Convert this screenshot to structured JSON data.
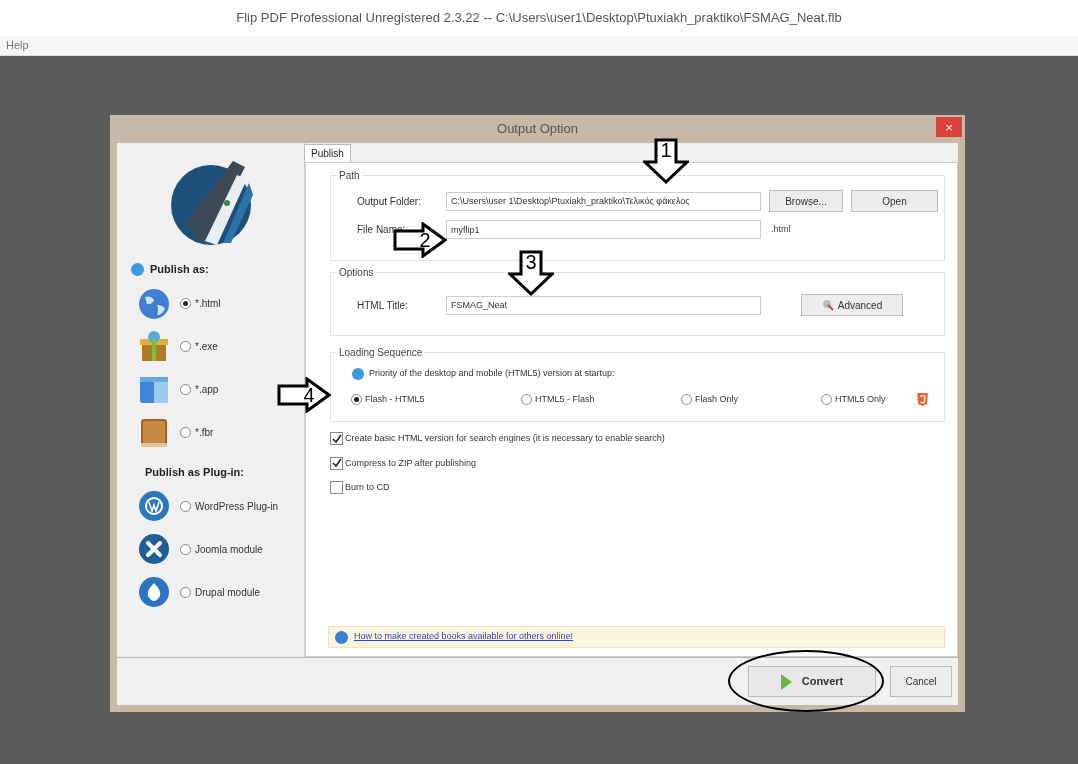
{
  "app_title": "Flip PDF Professional Unregistered 2.3.22  -- C:\\Users\\user1\\Desktop\\Ptuxiakh_praktiko\\FSMAG_Neat.flb",
  "menu": [
    "Help"
  ],
  "dialog": {
    "title": "Output Option",
    "close": "×",
    "tabs": [
      {
        "label": "Publish",
        "selected": true
      }
    ],
    "publish_as": {
      "heading": "Publish as:",
      "options": [
        {
          "label": "*.html",
          "selected": true,
          "kind": "globe"
        },
        {
          "label": "*.exe",
          "selected": false,
          "kind": "package"
        },
        {
          "label": "*.app",
          "selected": false,
          "kind": "window"
        },
        {
          "label": "*.fbr",
          "selected": false,
          "kind": "book"
        }
      ]
    },
    "plugins": {
      "heading": "Publish as Plug-in:",
      "options": [
        {
          "label": "WordPress Plug-in",
          "selected": false,
          "kind": "wordpress"
        },
        {
          "label": "Joomla module",
          "selected": false,
          "kind": "joomla"
        },
        {
          "label": "Drupal module",
          "selected": false,
          "kind": "drupal"
        }
      ]
    },
    "path": {
      "legend": "Path",
      "output_folder": {
        "label": "Output Folder:",
        "value": "C:\\Users\\user 1\\Desktop\\Ptuxiakh_praktiko\\Τελικός φάκελος"
      },
      "browse": "Browse...",
      "open": "Open",
      "file_name": {
        "label": "File Name:",
        "value": "myflip1"
      },
      "suffix": ".html"
    },
    "options": {
      "legend": "Options",
      "html_title": {
        "label": "HTML Title:",
        "value": "FSMAG_Neat"
      },
      "advanced": "Advanced"
    },
    "loading": {
      "legend": "Loading Sequence",
      "info": "Priority of the desktop and mobile (HTML5) version at startup:",
      "choices": [
        {
          "label": "Flash - HTML5",
          "selected": true
        },
        {
          "label": "HTML5 - Flash",
          "selected": false
        },
        {
          "label": "Flash Only",
          "selected": false
        },
        {
          "label": "HTML5 Only",
          "selected": false
        }
      ]
    },
    "checkboxes": [
      {
        "label": "Create basic HTML version for search engines (it is necessary to enable search)",
        "checked": true
      },
      {
        "label": "Compress to ZIP after publishing",
        "checked": true
      },
      {
        "label": "Burn to CD",
        "checked": false
      }
    ],
    "help_link": "How to make created books available for others online!",
    "buttons": [
      "Convert",
      "Cancel"
    ]
  },
  "annotations": [
    {
      "kind": "arrow_down",
      "label": "1"
    },
    {
      "kind": "arrow_right",
      "label": "2"
    },
    {
      "kind": "arrow_down",
      "label": "3"
    },
    {
      "kind": "arrow_right",
      "label": "4"
    },
    {
      "kind": "ellipse"
    }
  ]
}
